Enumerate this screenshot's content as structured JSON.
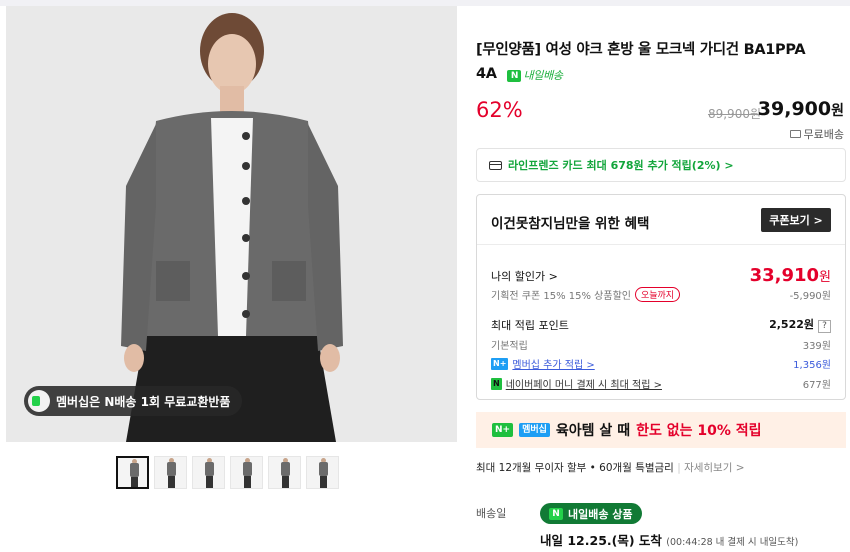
{
  "badge": {
    "text": "멤버십은 N배송 1회 무료교환반품"
  },
  "thumbnails": [
    {
      "selected": true
    },
    {
      "selected": false
    },
    {
      "selected": false
    },
    {
      "selected": false
    },
    {
      "selected": false
    },
    {
      "selected": false
    }
  ],
  "product": {
    "title_line1": "[무인양품] 여성 야크 혼방 울 모크넥 가디건 BA1PPA",
    "title_line2": "4A",
    "tomorrow_tag": "내일배송",
    "discount": "62%",
    "original_price": "89,900원",
    "price": "39,900",
    "price_unit": "원",
    "free_shipping": "무료배송"
  },
  "card_promo": {
    "text": "라인프렌즈 카드 최대 678원 추가 적립(2%) >"
  },
  "benefit": {
    "heading": "이건못참지님만을 위한 혜택",
    "coupon_button": "쿠폰보기 >",
    "my_price_label": "나의 할인가 >",
    "my_price": "33,910",
    "my_price_unit": "원",
    "coupon_line": "기획전 쿠폰 15% 15% 상품할인",
    "coupon_today": "오늘까지",
    "coupon_value": "-5,990원",
    "points_label": "최대 적립 포인트",
    "points_value": "2,522원",
    "points_help": "?",
    "basic_label": "기본적립",
    "basic_value": "339원",
    "member_label": "멤버십 추가 적립 >",
    "member_value": "1,356원",
    "npay_label": "네이버페이 머니 결제 시 최대 적립 >",
    "npay_value": "677원"
  },
  "banner": {
    "chip1": "N+",
    "chip2": "멤버십",
    "text_a": "육아템 살 때",
    "text_b": "한도 없는 10% 적립"
  },
  "installment": {
    "text": "최대 12개월 무이자 할부 • 60개월 특별금리",
    "more": "자세히보기 >"
  },
  "shipping": {
    "label": "배송일",
    "pill": "내일배송 상품",
    "arrive": "내일 12.25.(목) 도착",
    "arrive_note": "(00:44:28 내 결제 시 내일도착)"
  },
  "colors": {
    "accent_red": "#e4002b",
    "naver_green": "#1fbf3f",
    "link_blue": "#3b5bdb"
  }
}
